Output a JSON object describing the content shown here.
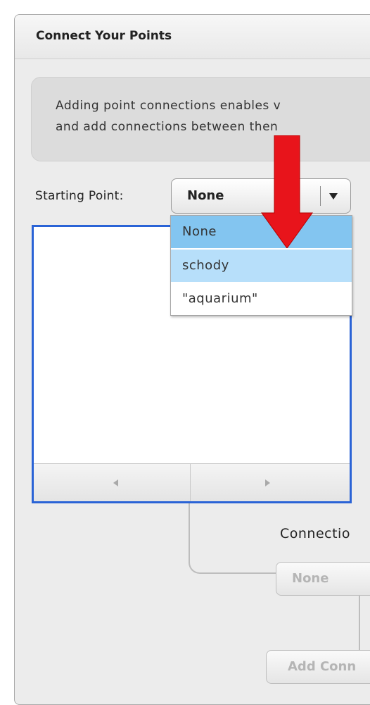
{
  "panel": {
    "title": "Connect Your Points"
  },
  "info": {
    "line1": "Adding point connections enables v",
    "line2": "and add connections between then"
  },
  "starting_point": {
    "label": "Starting Point:",
    "selected": "None",
    "options": [
      "None",
      "schody",
      "\"aquarium\""
    ],
    "highlight_color": "#83c5f0",
    "hover_color": "#b7dffa"
  },
  "listbox": {
    "border_color": "#2a63d6"
  },
  "connections": {
    "label": "Connectio",
    "select_value": "None",
    "add_button": "Add Conn"
  },
  "annotation": {
    "arrow_color": "#e8141b"
  }
}
